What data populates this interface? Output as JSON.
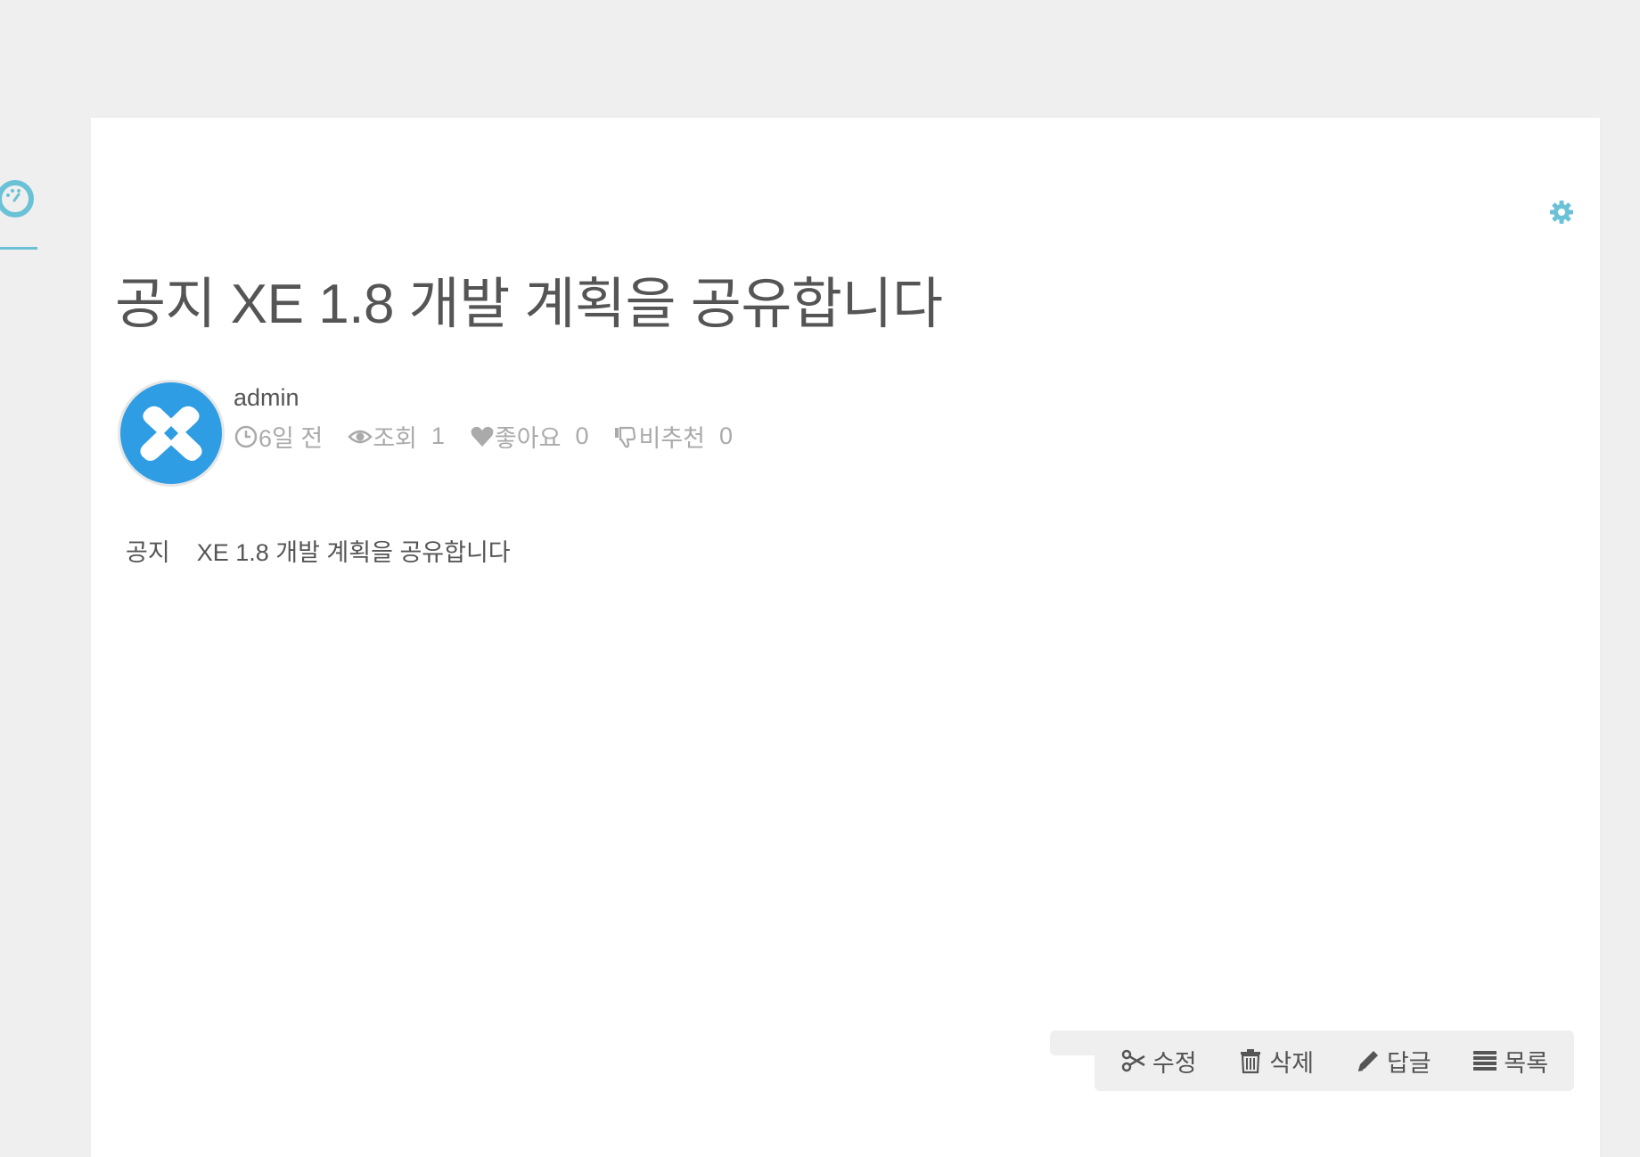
{
  "sidebar": {
    "icon": "dashboard-icon",
    "accent": "#6bc2d6"
  },
  "post": {
    "title": "공지 XE 1.8 개발 계획을 공유합니다",
    "author": "admin",
    "avatar_icon": "xe-logo-icon",
    "meta": {
      "time_icon": "clock-icon",
      "time": "6일 전",
      "views_icon": "eye-icon",
      "views_label": "조회",
      "views_value": "1",
      "likes_icon": "heart-icon",
      "likes_label": "좋아요",
      "likes_value": "0",
      "dislikes_icon": "thumbs-down-icon",
      "dislikes_label": "비추천",
      "dislikes_value": "0"
    },
    "body_tag": "공지",
    "body_text": "XE 1.8 개발 계획을 공유합니다"
  },
  "settings_icon": "gear-icon",
  "actions": {
    "edit": "수정",
    "delete": "삭제",
    "reply": "답글",
    "list": "목록"
  },
  "colors": {
    "accent": "#6bc2d6",
    "avatar_blue": "#2f9de4",
    "background": "#efefef"
  }
}
